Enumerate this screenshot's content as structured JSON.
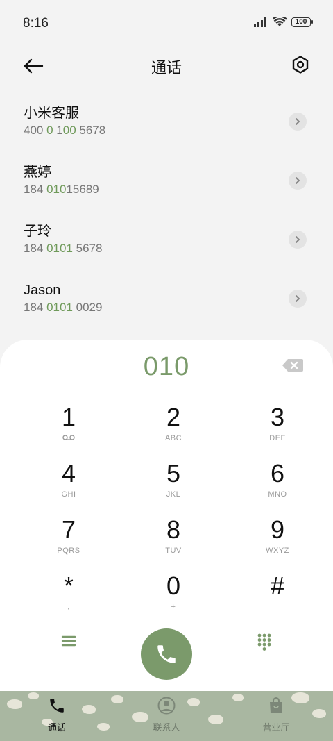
{
  "status": {
    "time": "8:16",
    "battery": "100"
  },
  "header": {
    "title": "通话"
  },
  "contacts": [
    {
      "name": "小米客服",
      "num_pre": "400 ",
      "num_hl": "0",
      "num_mid": " 1",
      "num_hl2": "00",
      "num_post": " 5678"
    },
    {
      "name": "燕婷",
      "num_pre": "184 ",
      "num_hl": "010",
      "num_mid": "",
      "num_hl2": "",
      "num_post": "15689"
    },
    {
      "name": "子玲",
      "num_pre": "184 ",
      "num_hl": "0101",
      "num_mid": "",
      "num_hl2": "",
      "num_post": " 5678"
    },
    {
      "name": "Jason",
      "num_pre": "184 ",
      "num_hl": "0101",
      "num_mid": "",
      "num_hl2": "",
      "num_post": " 0029"
    }
  ],
  "dialpad": {
    "input": "010",
    "keys": [
      {
        "digit": "1",
        "letters": ""
      },
      {
        "digit": "2",
        "letters": "ABC"
      },
      {
        "digit": "3",
        "letters": "DEF"
      },
      {
        "digit": "4",
        "letters": "GHI"
      },
      {
        "digit": "5",
        "letters": "JKL"
      },
      {
        "digit": "6",
        "letters": "MNO"
      },
      {
        "digit": "7",
        "letters": "PQRS"
      },
      {
        "digit": "8",
        "letters": "TUV"
      },
      {
        "digit": "9",
        "letters": "WXYZ"
      },
      {
        "digit": "*",
        "letters": ","
      },
      {
        "digit": "0",
        "letters": "+"
      },
      {
        "digit": "#",
        "letters": ""
      }
    ]
  },
  "nav": {
    "calls": "通话",
    "contacts": "联系人",
    "hall": "营业厅"
  },
  "colors": {
    "accent": "#7b9a6b",
    "highlight": "#6f9a5a"
  }
}
